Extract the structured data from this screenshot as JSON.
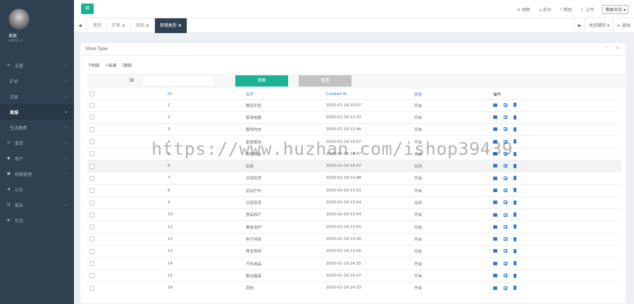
{
  "user": {
    "name": "系统",
    "role": "admin ▾"
  },
  "sidebar": {
    "items": [
      {
        "icon": "gear-icon",
        "glyph": "⚙",
        "label": "设置",
        "arrow": "‹",
        "sub": false,
        "active": false
      },
      {
        "icon": "",
        "glyph": "",
        "label": "矿机",
        "arrow": "‹",
        "sub": true,
        "active": false
      },
      {
        "icon": "",
        "glyph": "",
        "label": "交易",
        "arrow": "‹",
        "sub": true,
        "active": false
      },
      {
        "icon": "",
        "glyph": "",
        "label": "商城",
        "arrow": "‹",
        "sub": true,
        "active": true
      },
      {
        "icon": "",
        "glyph": "",
        "label": "生活缴费",
        "arrow": "‹",
        "sub": true,
        "active": false
      },
      {
        "icon": "bars-icon",
        "glyph": "≡",
        "label": "菜单",
        "arrow": "‹",
        "sub": false,
        "active": false
      },
      {
        "icon": "user-icon",
        "glyph": "●",
        "label": "用户",
        "arrow": "‹",
        "sub": false,
        "active": false
      },
      {
        "icon": "lock-icon",
        "glyph": "■",
        "label": "权限管理",
        "arrow": "‹",
        "sub": false,
        "active": false
      },
      {
        "icon": "bullhorn-icon",
        "glyph": "◀",
        "label": "公告",
        "arrow": "",
        "sub": false,
        "active": false
      },
      {
        "icon": "file-icon",
        "glyph": "▤",
        "label": "报告",
        "arrow": "‹",
        "sub": false,
        "active": false
      },
      {
        "icon": "log-icon",
        "glyph": "◉",
        "label": "日志",
        "arrow": "",
        "sub": false,
        "active": false
      }
    ]
  },
  "topbar": {
    "menu_glyph": "≡",
    "links": [
      {
        "icon": "refresh-icon",
        "glyph": "⟳",
        "label": "刷新"
      },
      {
        "icon": "home-icon",
        "glyph": "⌂",
        "label": "前台"
      },
      {
        "icon": "help-icon",
        "glyph": "?",
        "label": "帮助"
      },
      {
        "icon": "upload-icon",
        "glyph": "⇪",
        "label": "上传"
      }
    ],
    "language": "简体中文 ▾"
  },
  "tabs": {
    "left_glyph": "◀",
    "items": [
      {
        "label": "首页",
        "active": false
      },
      {
        "label": "矿机 ⊗",
        "active": false
      },
      {
        "label": "商品 ⊗",
        "active": false
      },
      {
        "label": "商铺类型 ⊗",
        "active": true
      }
    ],
    "right": [
      "▶",
      "关闭操作 ▾",
      "⇤ 退出"
    ]
  },
  "panel": {
    "title": "Store Type",
    "tools": "⌃ ✕",
    "toolbar": [
      {
        "icon": "refresh-icon",
        "glyph": "⟳",
        "label": "刷新"
      },
      {
        "icon": "plus-icon",
        "glyph": "+",
        "label": "新建"
      },
      {
        "icon": "trash-icon",
        "glyph": "▯",
        "label": "删除"
      }
    ],
    "search": {
      "label": "ID",
      "value": "",
      "placeholder": "",
      "search_label": "搜索",
      "reset_label": "重置"
    }
  },
  "table": {
    "headers": [
      "ID",
      "名字",
      "Created At",
      "状态",
      "操作"
    ],
    "rows": [
      {
        "id": "1",
        "name": "数码手机",
        "created": "2020-01-18 10:07",
        "status": "开启"
      },
      {
        "id": "2",
        "name": "家用电器",
        "created": "2020-01-18 11:33",
        "status": "开启"
      },
      {
        "id": "3",
        "name": "服饰内衣",
        "created": "2020-01-18 12:46",
        "status": "开启"
      },
      {
        "id": "4",
        "name": "家居家纺",
        "created": "2020-01-18 13:47",
        "status": "开启"
      },
      {
        "id": "5",
        "name": "母婴用品",
        "created": "2020-01-18 13:47",
        "status": "开启"
      },
      {
        "id": "6",
        "name": "玩具",
        "created": "2020-01-18 13:47",
        "status": "关闭"
      },
      {
        "id": "7",
        "name": "日用百货",
        "created": "2020-01-18 12:48",
        "status": "开启"
      },
      {
        "id": "8",
        "name": "运动户外",
        "created": "2020-01-18 13:52",
        "status": "开启"
      },
      {
        "id": "9",
        "name": "日用百货",
        "created": "2020-01-18 13:54",
        "status": "关闭"
      },
      {
        "id": "10",
        "name": "食品特产",
        "created": "2020-01-18 13:54",
        "status": "开启"
      },
      {
        "id": "11",
        "name": "美妆洗护",
        "created": "2020-01-18 13:55",
        "status": "开启"
      },
      {
        "id": "12",
        "name": "电子科技",
        "created": "2020-01-18 13:56",
        "status": "开启"
      },
      {
        "id": "13",
        "name": "珠宝首饰",
        "created": "2020-01-18 13:56",
        "status": "开启"
      },
      {
        "id": "14",
        "name": "汽车用品",
        "created": "2020-01-18 14:25",
        "status": "开启"
      },
      {
        "id": "15",
        "name": "鞋包箱袋",
        "created": "2020-01-18 14:27",
        "status": "开启"
      },
      {
        "id": "16",
        "name": "其他",
        "created": "2020-01-18 14:33",
        "status": "开启"
      }
    ]
  },
  "watermark": "https://www.huzhan.com/ishop39439"
}
